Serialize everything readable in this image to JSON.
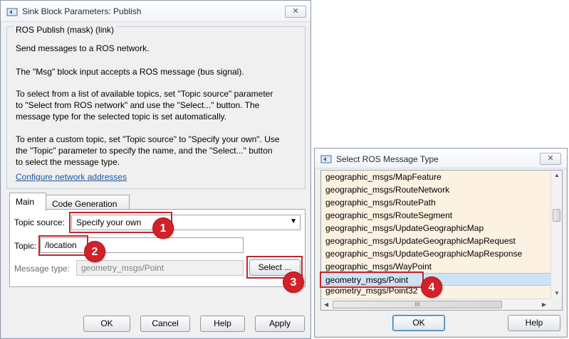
{
  "params_dialog": {
    "title": "Sink Block Parameters: Publish",
    "close_label": "✕",
    "section_label": "ROS Publish (mask) (link)",
    "description": [
      "Send messages to a ROS network.",
      "The \"Msg\" block input accepts a ROS message (bus signal).",
      "To select from a list of available topics, set \"Topic source\" parameter",
      "to \"Select from ROS network\" and use the \"Select...\" button. The",
      "message type for the selected topic is set automatically.",
      "To enter a custom topic, set \"Topic source\" to \"Specify your own\". Use",
      "the \"Topic\" parameter to specify the name, and the \"Select...\" button",
      "to select the message type."
    ],
    "link_text": "Configure network addresses",
    "tabs": [
      "Main",
      "Code Generation"
    ],
    "topic_source_label": "Topic source:",
    "topic_source_value": "Specify your own",
    "topic_label": "Topic:",
    "topic_value": "/location",
    "message_type_label": "Message type:",
    "message_type_value": "geometry_msgs/Point",
    "select_button": "Select ...",
    "buttons": {
      "ok": "OK",
      "cancel": "Cancel",
      "help": "Help",
      "apply": "Apply"
    }
  },
  "type_dialog": {
    "title": "Select ROS Message Type",
    "close_label": "✕",
    "items": [
      "geographic_msgs/MapFeature",
      "geographic_msgs/RouteNetwork",
      "geographic_msgs/RoutePath",
      "geographic_msgs/RouteSegment",
      "geographic_msgs/UpdateGeographicMap",
      "geographic_msgs/UpdateGeographicMapRequest",
      "geographic_msgs/UpdateGeographicMapResponse",
      "geographic_msgs/WayPoint",
      "geometry_msgs/Point",
      "geometry_msgs/Point32"
    ],
    "selected_item": "geometry_msgs/Point",
    "scroll_grip": "III",
    "buttons": {
      "ok": "OK",
      "help": "Help"
    }
  },
  "callouts": [
    "1",
    "2",
    "3",
    "4"
  ],
  "colors": {
    "callout": "#d52029",
    "list_background": "#fdf2e2",
    "link": "#1a55a8"
  }
}
